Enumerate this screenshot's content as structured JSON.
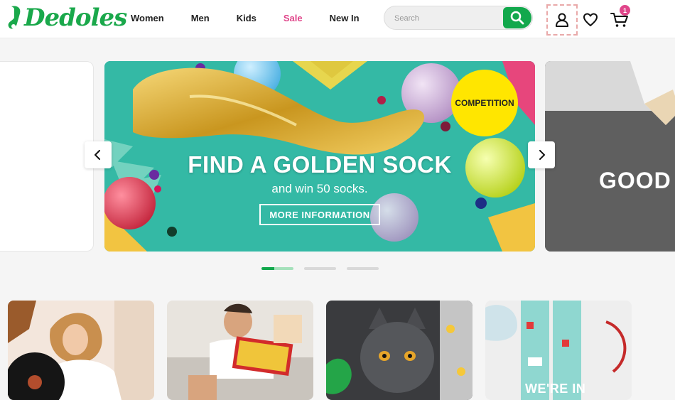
{
  "brand": {
    "logo_text": "Dedoles",
    "accent": "#12a84c",
    "sale_color": "#e0458a"
  },
  "nav": {
    "items": [
      {
        "label": "Women"
      },
      {
        "label": "Men"
      },
      {
        "label": "Kids"
      },
      {
        "label": "Sale"
      },
      {
        "label": "New In"
      }
    ]
  },
  "search": {
    "placeholder": "Search",
    "value": "",
    "icon": "search-icon"
  },
  "header_icons": {
    "user": "user-icon",
    "wishlist": "heart-icon",
    "cart": "cart-icon",
    "cart_count": "1"
  },
  "carousel": {
    "main": {
      "badge": "COMPETITION",
      "headline": "FIND A GOLDEN SOCK",
      "subline": "and win 50 socks.",
      "button": "MORE INFORMATION"
    },
    "next_peek_text": "GOOD",
    "dots": 3,
    "active_dot": 0
  },
  "categories": [
    {
      "label": ""
    },
    {
      "label": ""
    },
    {
      "label": ""
    },
    {
      "label": "WE'RE IN"
    }
  ]
}
